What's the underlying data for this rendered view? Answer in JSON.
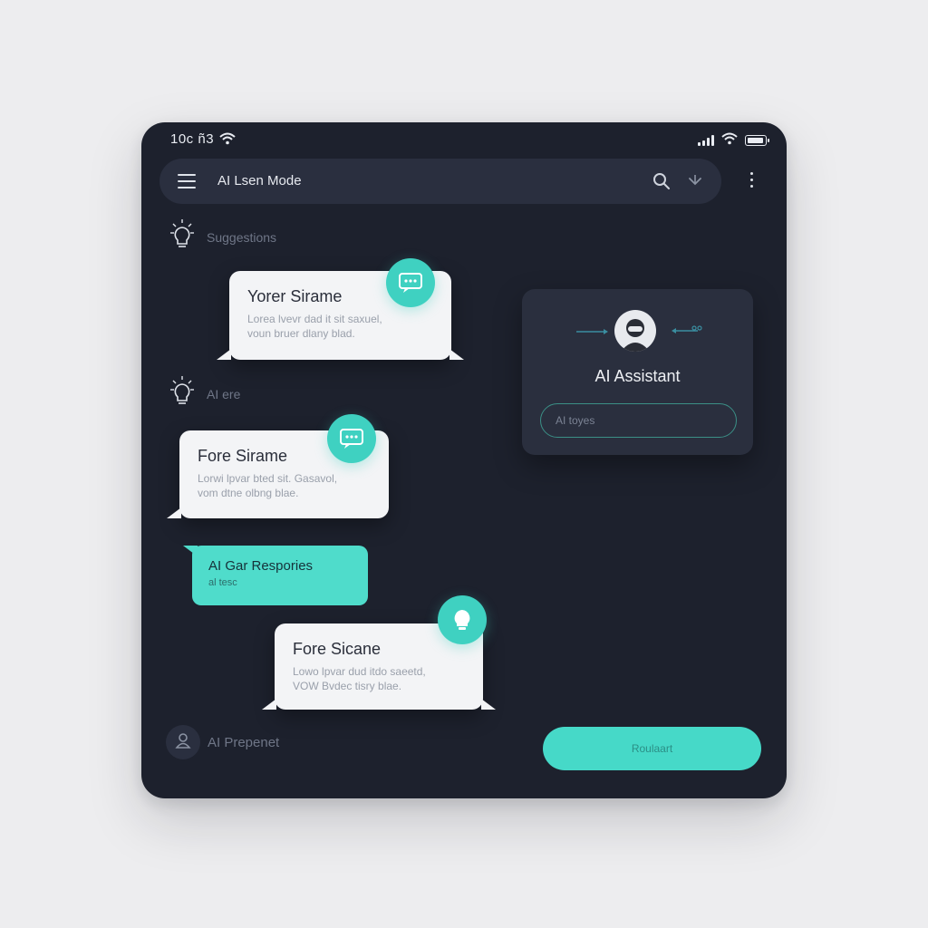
{
  "status_bar": {
    "time": "10c ñ3"
  },
  "top_bar": {
    "title": "AI Lsen Mode"
  },
  "sections": {
    "suggestions": "Suggestions",
    "alerts": "AI ere"
  },
  "bubbles": [
    {
      "title": "Yorer Sirame",
      "line1": "Lorea lvevr dad it sit saxuel,",
      "line2": "voun bruer dlany blad."
    },
    {
      "title": "Fore Sirame",
      "line1": "Lorwi lpvar bted sit. Gasavol,",
      "line2": "vom dtne olbng blae."
    },
    {
      "title": "Fore Sicane",
      "line1": "Lowo lpvar dud itdo saeetd,",
      "line2": "VOW Bvdec tisry blae."
    }
  ],
  "teal_bubble": {
    "title": "AI Gar Respories",
    "sub": "al tesc"
  },
  "assistant_card": {
    "title": "AI Assistant",
    "input_placeholder": "AI toyes"
  },
  "bottom": {
    "label": "AI Prepenet",
    "button": "Roulaart"
  },
  "colors": {
    "accent": "#46d9c8",
    "panel": "#1d212d",
    "card": "#2a2f3e",
    "bubble": "#f3f4f6"
  }
}
